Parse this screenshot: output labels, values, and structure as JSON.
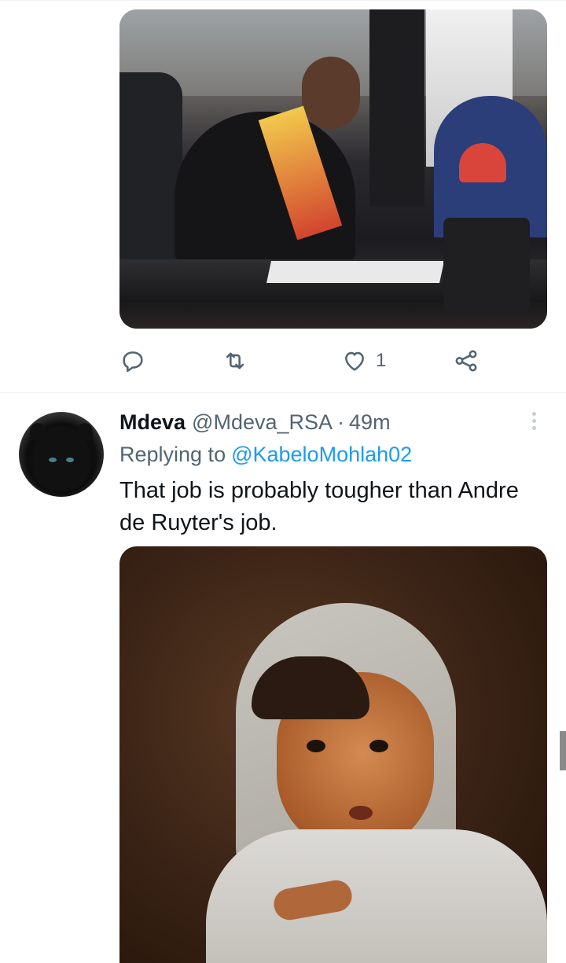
{
  "first_tweet": {
    "actions": {
      "reply_icon": "reply-icon",
      "retweet_icon": "retweet-icon",
      "like_icon": "heart-icon",
      "like_count": "1",
      "share_icon": "share-icon"
    }
  },
  "second_tweet": {
    "display_name": "Mdeva",
    "handle": "@Mdeva_RSA",
    "separator": "·",
    "time": "49m",
    "replying_prefix": "Replying to",
    "replying_to": "@KabeloMohlah02",
    "text": "That job is probably tougher than Andre de Ruyter's job."
  },
  "colors": {
    "accent": "#1d9bf0",
    "secondary_text": "#536471",
    "primary_text": "#0f1419",
    "divider": "#eff3f4"
  }
}
